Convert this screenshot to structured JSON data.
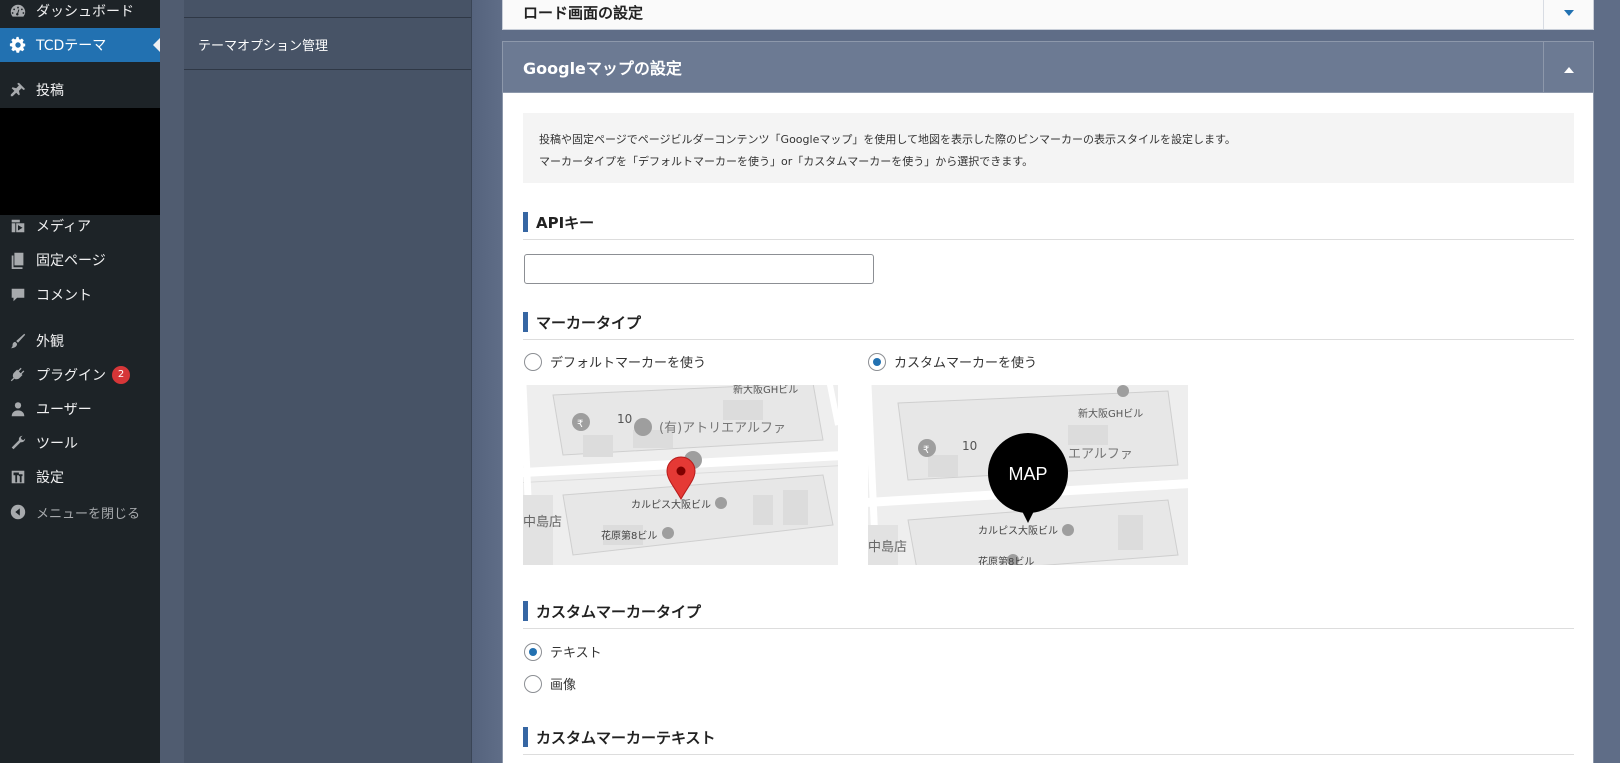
{
  "sidebar": {
    "items": [
      {
        "label": "ダッシュボード",
        "icon": "dashboard-icon"
      },
      {
        "label": "TCDテーマ",
        "icon": "gear-icon",
        "active": true
      },
      {
        "label": "投稿",
        "icon": "pin-icon"
      },
      {
        "label": "メディア",
        "icon": "media-icon"
      },
      {
        "label": "固定ページ",
        "icon": "page-icon"
      },
      {
        "label": "コメント",
        "icon": "comment-icon"
      },
      {
        "label": "外観",
        "icon": "brush-icon"
      },
      {
        "label": "プラグイン",
        "icon": "plugin-icon",
        "badge": "2"
      },
      {
        "label": "ユーザー",
        "icon": "user-icon"
      },
      {
        "label": "ツール",
        "icon": "wrench-icon"
      },
      {
        "label": "設定",
        "icon": "settings-icon"
      },
      {
        "label": "メニューを閉じる",
        "icon": "collapse-icon"
      }
    ]
  },
  "tcd_menu": {
    "items": [
      {
        "label": "テーマオプション管理"
      }
    ]
  },
  "accordions": {
    "load_title": "ロード画面の設定",
    "map_title": "Googleマップの設定"
  },
  "notice": {
    "line1": "投稿や固定ページでページビルダーコンテンツ「Googleマップ」を使用して地図を表示した際のピンマーカーの表示スタイルを設定します。",
    "line2": "マーカータイプを「デフォルトマーカーを使う」or「カスタムマーカーを使う」から選択できます。"
  },
  "api": {
    "title": "APIキー",
    "value": ""
  },
  "marker_type": {
    "title": "マーカータイプ",
    "options": [
      {
        "label": "デフォルトマーカーを使う",
        "checked": false
      },
      {
        "label": "カスタムマーカーを使う",
        "checked": true
      }
    ]
  },
  "map_labels": {
    "bldg_gh": "新大阪GHビル",
    "num_10": "10",
    "atelier": "(有)アトリエアルファ",
    "atelier_short": "エアルファ",
    "calpis": "カルピス大阪ビル",
    "hanahara": "花原第8ビル",
    "hanahara_partial": "花原第8ビル",
    "nakajima": "中島店",
    "yen": "₹",
    "custom_marker_text": "MAP"
  },
  "custom_marker_type": {
    "title": "カスタムマーカータイプ",
    "options": [
      {
        "label": "テキスト",
        "checked": true
      },
      {
        "label": "画像",
        "checked": false
      }
    ]
  },
  "custom_marker_text": {
    "title": "カスタムマーカーテキスト"
  },
  "colors": {
    "wp_sidebar": "#1d2327",
    "wp_active": "#2271b1",
    "panel_header": "#6c7a93",
    "accent_bar": "#3666a3",
    "marker_red": "#e53935"
  }
}
